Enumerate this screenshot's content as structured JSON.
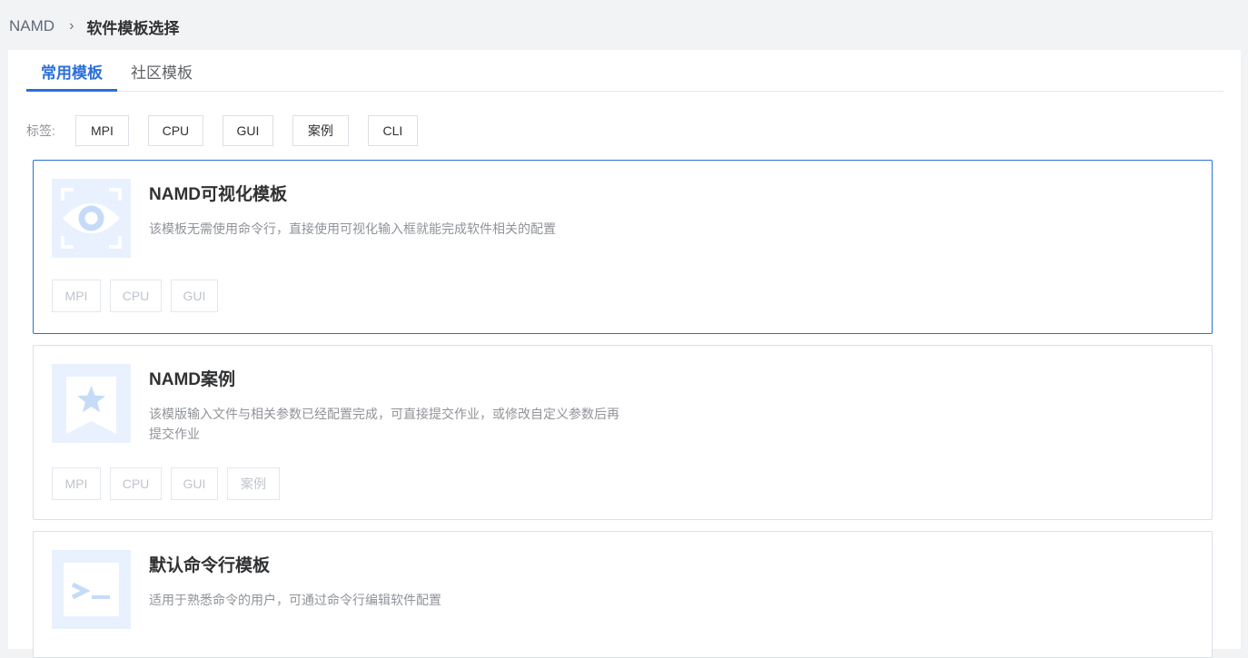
{
  "breadcrumb": {
    "root": "NAMD",
    "separator": "›",
    "current": "软件模板选择"
  },
  "tabs": [
    {
      "label": "常用模板",
      "active": true
    },
    {
      "label": "社区模板",
      "active": false
    }
  ],
  "filters": {
    "label": "标签:",
    "tags": [
      "MPI",
      "CPU",
      "GUI",
      "案例",
      "CLI"
    ]
  },
  "cards": [
    {
      "title": "NAMD可视化模板",
      "icon": "eye-icon",
      "description": "该模板无需使用命令行，直接使用可视化输入框就能完成软件相关的配置",
      "tags": [
        "MPI",
        "CPU",
        "GUI"
      ],
      "selected": true
    },
    {
      "title": "NAMD案例",
      "icon": "star-bookmark-icon",
      "description": "该模版输入文件与相关参数已经配置完成，可直接提交作业，或修改自定义参数后再提交作业",
      "tags": [
        "MPI",
        "CPU",
        "GUI",
        "案例"
      ],
      "selected": false
    },
    {
      "title": "默认命令行模板",
      "icon": "terminal-icon",
      "description": "适用于熟悉命令的用户，可通过命令行编辑软件配置",
      "tags": [],
      "selected": false
    }
  ],
  "colors": {
    "accent": "#2b6fd8",
    "icon_bg": "#e8f1fd",
    "icon_fg": "#c5dbf7"
  }
}
